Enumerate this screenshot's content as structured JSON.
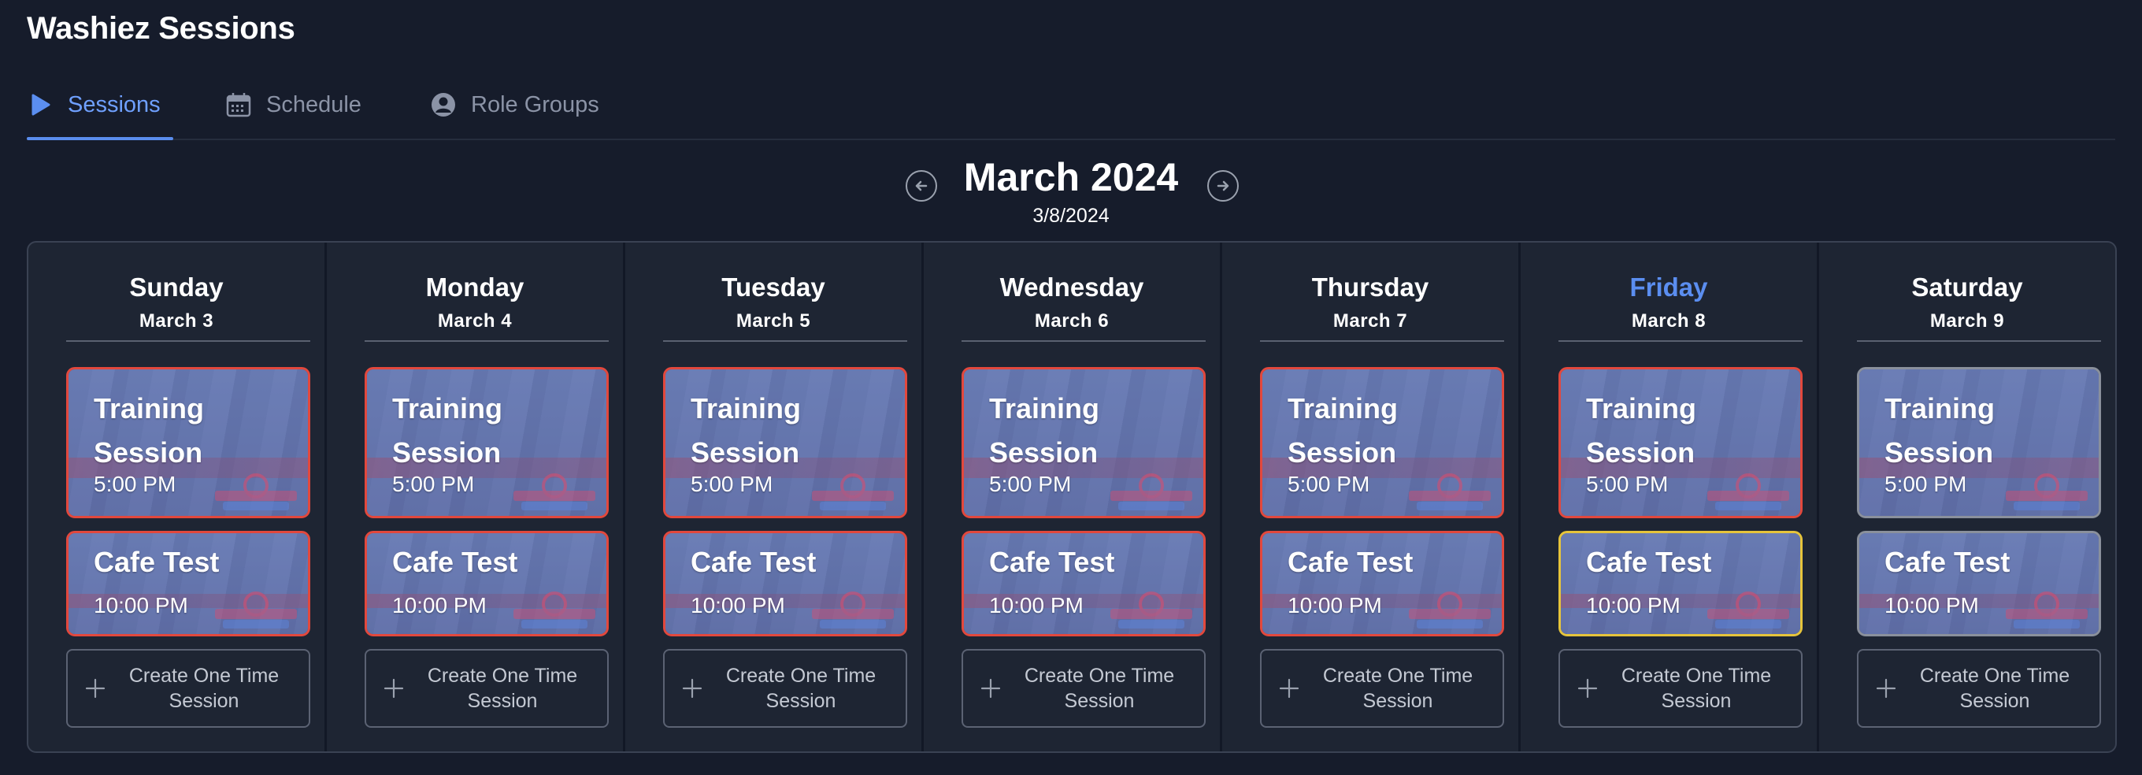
{
  "app": {
    "title": "Washiez Sessions"
  },
  "tabs": [
    {
      "label": "Sessions",
      "icon": "play-icon",
      "active": true
    },
    {
      "label": "Schedule",
      "icon": "calendar-icon",
      "active": false
    },
    {
      "label": "Role Groups",
      "icon": "user-circle-icon",
      "active": false
    }
  ],
  "calendar": {
    "month_label": "March 2024",
    "selected_date": "3/8/2024",
    "create_label": "Create One Time Session",
    "days": [
      {
        "name": "Sunday",
        "date": "March 3",
        "today": false,
        "sessions": [
          {
            "name": "Training Session",
            "time": "5:00 PM",
            "status": "red"
          },
          {
            "name": "Cafe Test",
            "time": "10:00 PM",
            "status": "red"
          }
        ]
      },
      {
        "name": "Monday",
        "date": "March 4",
        "today": false,
        "sessions": [
          {
            "name": "Training Session",
            "time": "5:00 PM",
            "status": "red"
          },
          {
            "name": "Cafe Test",
            "time": "10:00 PM",
            "status": "red"
          }
        ]
      },
      {
        "name": "Tuesday",
        "date": "March 5",
        "today": false,
        "sessions": [
          {
            "name": "Training Session",
            "time": "5:00 PM",
            "status": "red"
          },
          {
            "name": "Cafe Test",
            "time": "10:00 PM",
            "status": "red"
          }
        ]
      },
      {
        "name": "Wednesday",
        "date": "March 6",
        "today": false,
        "sessions": [
          {
            "name": "Training Session",
            "time": "5:00 PM",
            "status": "red"
          },
          {
            "name": "Cafe Test",
            "time": "10:00 PM",
            "status": "red"
          }
        ]
      },
      {
        "name": "Thursday",
        "date": "March 7",
        "today": false,
        "sessions": [
          {
            "name": "Training Session",
            "time": "5:00 PM",
            "status": "red"
          },
          {
            "name": "Cafe Test",
            "time": "10:00 PM",
            "status": "red"
          }
        ]
      },
      {
        "name": "Friday",
        "date": "March 8",
        "today": true,
        "sessions": [
          {
            "name": "Training Session",
            "time": "5:00 PM",
            "status": "red"
          },
          {
            "name": "Cafe Test",
            "time": "10:00 PM",
            "status": "yellow"
          }
        ]
      },
      {
        "name": "Saturday",
        "date": "March 9",
        "today": false,
        "sessions": [
          {
            "name": "Training Session",
            "time": "5:00 PM",
            "status": "gray"
          },
          {
            "name": "Cafe Test",
            "time": "10:00 PM",
            "status": "gray"
          }
        ]
      }
    ]
  },
  "colors": {
    "background": "#161c2b",
    "accent": "#5b8ef0",
    "status_red": "#e2483d",
    "status_yellow": "#e6c43b",
    "status_gray": "#8a909c"
  }
}
